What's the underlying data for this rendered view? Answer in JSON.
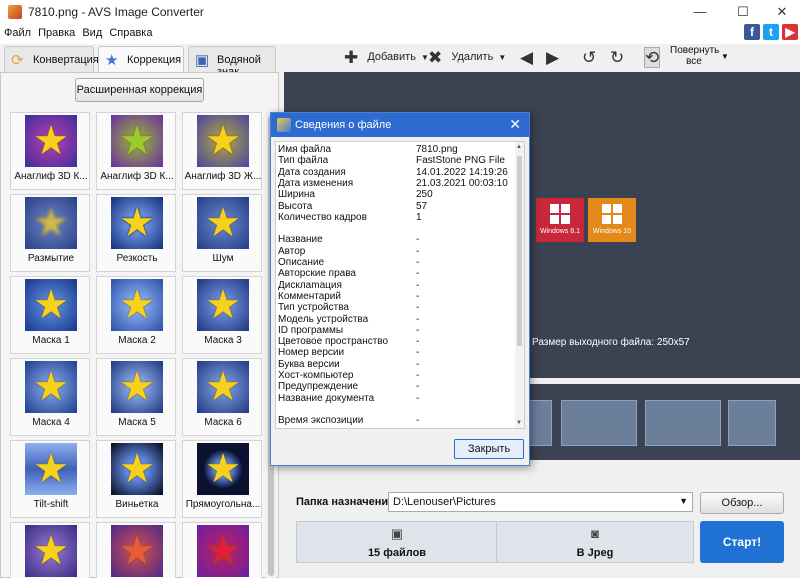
{
  "window": {
    "title": "7810.png - AVS Image Converter",
    "minimize": "—",
    "maximize": "☐",
    "close": "✕"
  },
  "menu": [
    "Файл",
    "Правка",
    "Вид",
    "Справка"
  ],
  "tabs": [
    {
      "label": "Конвертация",
      "icon": "convert-icon"
    },
    {
      "label": "Коррекция",
      "icon": "star-icon"
    },
    {
      "label": "Водяной знак",
      "icon": "watermark-icon"
    }
  ],
  "toolbar": {
    "add": "Добавить",
    "delete": "Удалить",
    "rotate_all": "Повернуть",
    "rotate_all_2": "все"
  },
  "left": {
    "advanced_button": "Расширенная коррекция",
    "effects": [
      "Анаглиф 3D К...",
      "Анаглиф 3D К...",
      "Анаглиф 3D Ж...",
      "Размытие",
      "Резкость",
      "Шум",
      "Маска 1",
      "Маска 2",
      "Маска 3",
      "Маска 4",
      "Маска 5",
      "Маска 6",
      "Tilt-shift",
      "Виньетка",
      "Прямоугольна...",
      "",
      "",
      ""
    ]
  },
  "preview": {
    "tile1": "Windows 8.1",
    "tile2": "Windows 10",
    "output_size": "Размер выходного файла: 250x57"
  },
  "destination": {
    "label": "Папка назначения:",
    "path": "D:\\Lenouser\\Pictures",
    "browse": "Обзор..."
  },
  "steps": {
    "files": "15 файлов",
    "format": "В Jpeg",
    "start": "Старт!"
  },
  "dialog": {
    "title": "Сведения о файле",
    "close_button": "Закрыть",
    "rows": [
      {
        "k": "Имя файла",
        "v": "7810.png"
      },
      {
        "k": "Тип файла",
        "v": "FastStone PNG File"
      },
      {
        "k": "Дата создания",
        "v": "14.01.2022 14:19:26"
      },
      {
        "k": "Дата изменения",
        "v": "21.03.2021 00:03:10"
      },
      {
        "k": "Ширина",
        "v": "250"
      },
      {
        "k": "Высота",
        "v": "57"
      },
      {
        "k": "Количество кадров",
        "v": "1"
      },
      {
        "k": "",
        "v": ""
      },
      {
        "k": "Название",
        "v": "-"
      },
      {
        "k": "Автор",
        "v": "-"
      },
      {
        "k": "Описание",
        "v": "-"
      },
      {
        "k": "Авторские права",
        "v": "-"
      },
      {
        "k": "Дисклamация",
        "v": "-"
      },
      {
        "k": "Комментарий",
        "v": "-"
      },
      {
        "k": "Тип устройства",
        "v": "-"
      },
      {
        "k": "Модель устройства",
        "v": "-"
      },
      {
        "k": "ID программы",
        "v": "-"
      },
      {
        "k": "Цветовое пространство",
        "v": "-"
      },
      {
        "k": "Номер версии",
        "v": "-"
      },
      {
        "k": "Буква версии",
        "v": "-"
      },
      {
        "k": "Хост-компьютер",
        "v": "-"
      },
      {
        "k": "Предупреждение",
        "v": "-"
      },
      {
        "k": "Название документа",
        "v": "-"
      },
      {
        "k": "",
        "v": ""
      },
      {
        "k": "Время экспозиции",
        "v": "-"
      }
    ]
  },
  "colors": {
    "accent": "#2d6bd0",
    "start": "#1f72d4",
    "preview_bg": "#3b4352"
  }
}
